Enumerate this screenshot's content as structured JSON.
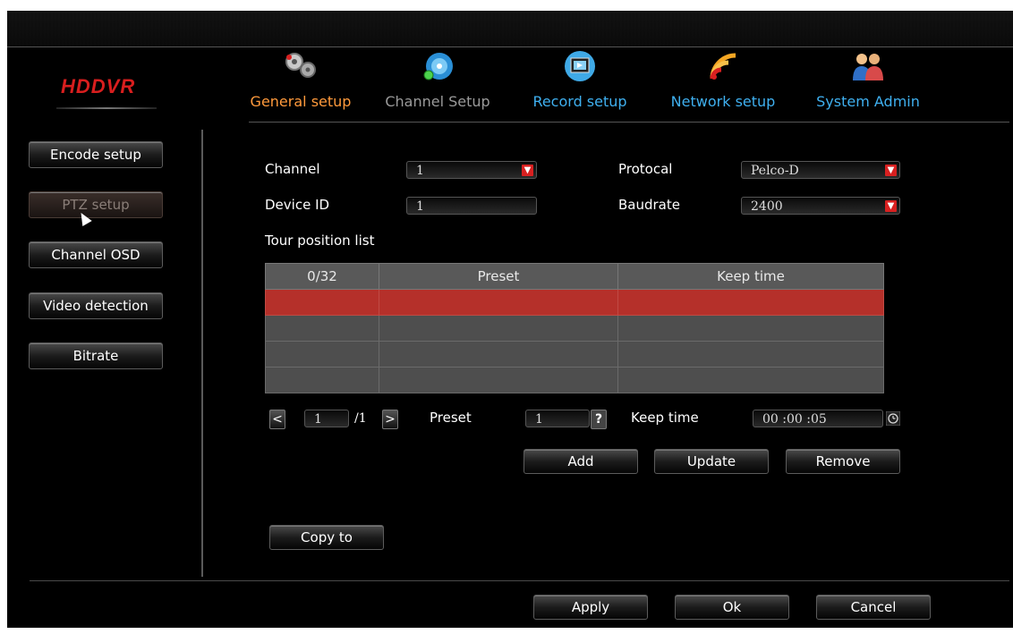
{
  "brand": "HDDVR",
  "top_tabs": [
    {
      "label": "General setup",
      "icon": "gears-icon",
      "color": "#ff9a3c"
    },
    {
      "label": "Channel Setup",
      "icon": "channel-disc-icon",
      "color": "#9a9a9a"
    },
    {
      "label": "Record setup",
      "icon": "record-film-icon",
      "color": "#3fb0f0"
    },
    {
      "label": "Network setup",
      "icon": "wifi-signal-icon",
      "color": "#3fb0f0"
    },
    {
      "label": "System Admin",
      "icon": "users-icon",
      "color": "#3fb0f0"
    }
  ],
  "side_menu": [
    {
      "label": "Encode setup"
    },
    {
      "label": "PTZ setup",
      "active": true
    },
    {
      "label": "Channel OSD"
    },
    {
      "label": "Video detection"
    },
    {
      "label": "Bitrate"
    }
  ],
  "form": {
    "channel_label": "Channel",
    "channel_value": "1",
    "device_id_label": "Device ID",
    "device_id_value": "1",
    "protocol_label": "Protocal",
    "protocol_value": "Pelco-D",
    "baudrate_label": "Baudrate",
    "baudrate_value": "2400"
  },
  "tour": {
    "title": "Tour position list",
    "headers": [
      "0/32",
      "Preset",
      "Keep time"
    ],
    "rows": [
      [
        "",
        "",
        ""
      ],
      [
        "",
        "",
        ""
      ],
      [
        "",
        "",
        ""
      ],
      [
        "",
        "",
        ""
      ]
    ],
    "selected_row": 0
  },
  "pager": {
    "prev": "<",
    "page": "1",
    "total": "/1",
    "next": ">",
    "preset_label": "Preset",
    "preset_value": "1",
    "help": "?",
    "keep_time_label": "Keep time",
    "keep_time_value": "00 :00 :05"
  },
  "actions": {
    "add": "Add",
    "update": "Update",
    "remove": "Remove",
    "copy_to": "Copy to"
  },
  "footer": {
    "apply": "Apply",
    "ok": "Ok",
    "cancel": "Cancel"
  },
  "colors": {
    "accent_red": "#d82020",
    "selected_row": "#b5302a",
    "active_tab": "#ff9a3c",
    "tab_blue": "#3fb0f0"
  }
}
